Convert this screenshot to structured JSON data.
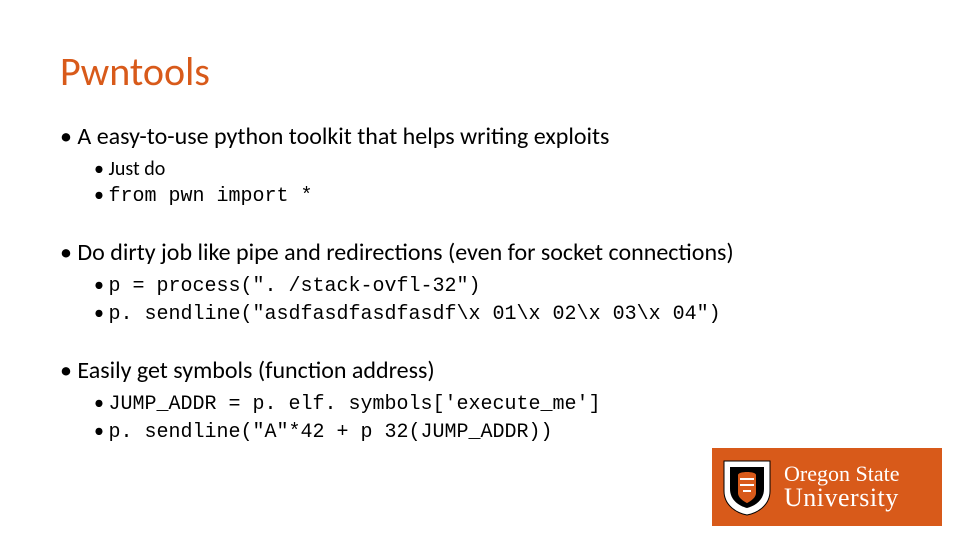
{
  "title": "Pwntools",
  "bullets": [
    {
      "text": "A easy-to-use python toolkit that helps writing exploits",
      "sub": [
        {
          "text": "Just do",
          "mono": false
        },
        {
          "text": "from pwn import *",
          "mono": true
        }
      ]
    },
    {
      "text": "Do dirty job like pipe and redirections (even for socket connections)",
      "sub": [
        {
          "text": "p = process(\". /stack-ovfl-32\")",
          "mono": true
        },
        {
          "text": "p. sendline(\"asdfasdfasdfasdf\\x 01\\x 02\\x 03\\x 04\")",
          "mono": true
        }
      ]
    },
    {
      "text": "Easily get symbols (function address)",
      "sub": [
        {
          "text": "JUMP_ADDR = p. elf. symbols['execute_me']",
          "mono": true
        },
        {
          "text": "p. sendline(\"A\"*42 + p 32(JUMP_ADDR))",
          "mono": true
        }
      ]
    }
  ],
  "logo": {
    "line1": "Oregon State",
    "line2": "University"
  }
}
